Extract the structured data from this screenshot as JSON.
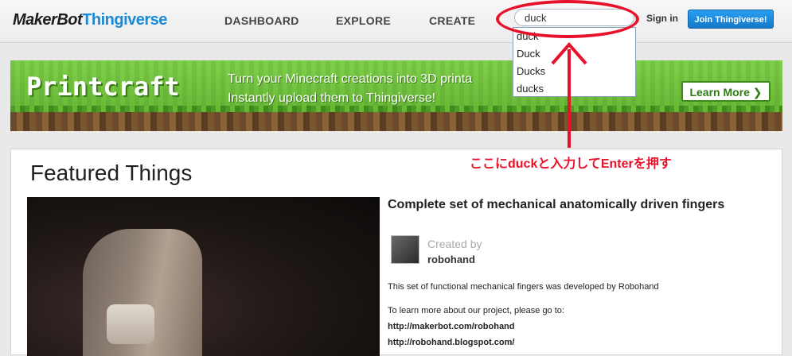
{
  "header": {
    "logo_part1": "MakerBot",
    "logo_part2": "Thingiverse",
    "nav": [
      "DASHBOARD",
      "EXPLORE",
      "CREATE"
    ],
    "search": {
      "value": "duck",
      "placeholder": ""
    },
    "signin": "Sign in",
    "join": "Join Thingiverse!"
  },
  "autocomplete": {
    "items": [
      "duck",
      "Duck",
      "Ducks",
      "ducks"
    ]
  },
  "banner": {
    "title": "Printcraft",
    "line1": "Turn your Minecraft creations into 3D printa",
    "line2": "Instantly upload them to Thingiverse!",
    "cta": "Learn More ❯"
  },
  "featured": {
    "heading": "Featured Things",
    "thing": {
      "title": "Complete set of mechanical anatomically driven fingers",
      "created_by_label": "Created by",
      "author": "robohand",
      "description": "This set of functional mechanical fingers was developed by Robohand",
      "learn_more": "To learn more about our project, please go to:",
      "link1": "http://makerbot.com/robohand",
      "link2": "http://robohand.blogspot.com/"
    }
  },
  "annotation": {
    "text": "ここにduckと入力してEnterを押す",
    "color": "#e8112a"
  },
  "colors": {
    "accent": "#1a8ad4",
    "join_button": "#1478c9",
    "annotation": "#e8112a"
  }
}
